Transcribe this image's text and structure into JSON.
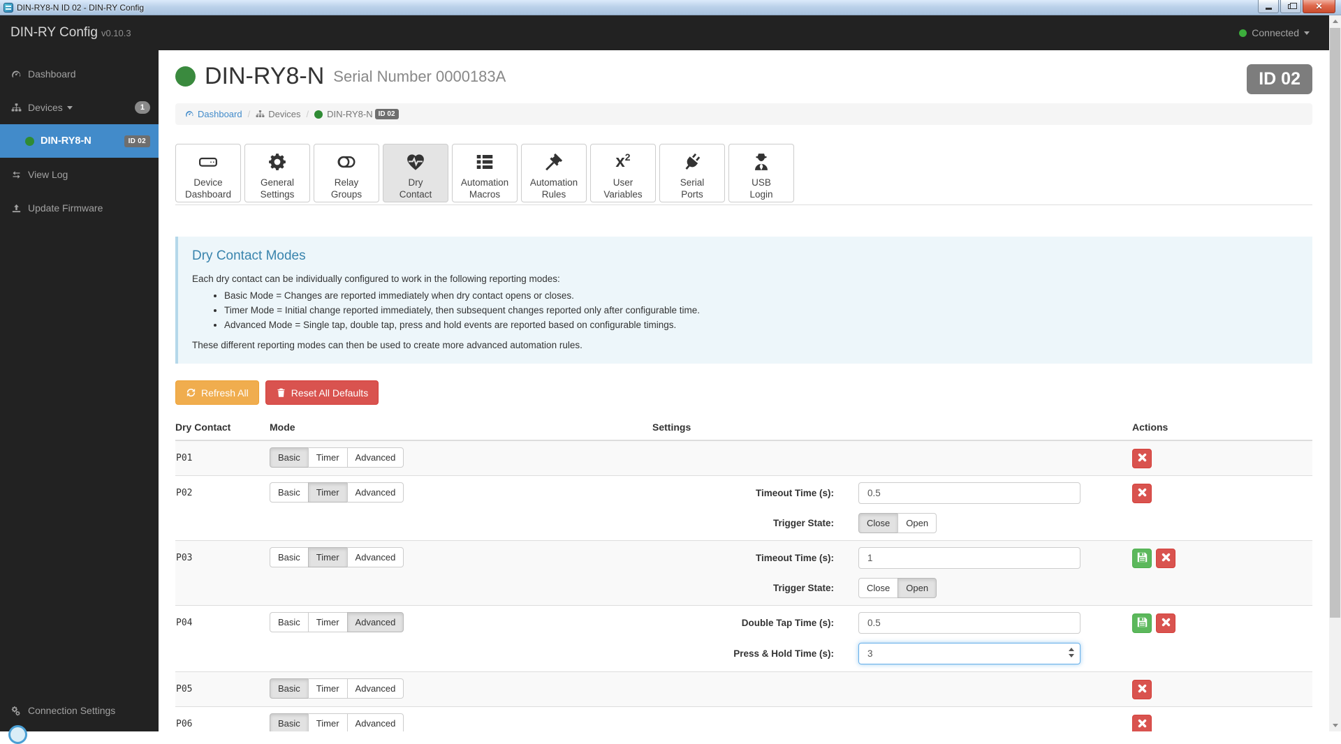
{
  "window": {
    "title": "DIN-RY8-N ID 02 - DIN-RY Config"
  },
  "app": {
    "brand": "DIN-RY Config",
    "version": "v0.10.3",
    "connection_status": "Connected",
    "status_color": "#3cae3c"
  },
  "sidebar": {
    "items": [
      {
        "label": "Dashboard",
        "icon": "dashboard-icon",
        "active": false
      },
      {
        "label": "Devices",
        "icon": "sitemap-icon",
        "caret": true,
        "badge": "1",
        "active": false
      },
      {
        "label": "DIN-RY8-N",
        "icon": "green-dot",
        "badge": "ID 02",
        "active": true
      },
      {
        "label": "View Log",
        "icon": "exchange-icon",
        "active": false
      },
      {
        "label": "Update Firmware",
        "icon": "upload-icon",
        "active": false
      }
    ],
    "footer": {
      "label": "Connection Settings",
      "icon": "cogs-icon"
    }
  },
  "page": {
    "device_name": "DIN-RY8-N",
    "serial_label": "Serial Number 0000183A",
    "id_badge": "ID 02",
    "status_color": "#3a8a3e",
    "breadcrumb": [
      {
        "label": "Dashboard",
        "icon": "dashboard-icon",
        "link": true
      },
      {
        "label": "Devices",
        "icon": "sitemap-icon",
        "link": false
      },
      {
        "label": "DIN-RY8-N",
        "icon": "green-dot",
        "badge": "ID 02",
        "link": false
      }
    ]
  },
  "tabs": [
    {
      "lines": [
        "Device",
        "Dashboard"
      ],
      "icon": "hdd-icon",
      "active": false
    },
    {
      "lines": [
        "General",
        "Settings"
      ],
      "icon": "gear-icon",
      "active": false
    },
    {
      "lines": [
        "Relay",
        "Groups"
      ],
      "icon": "toggle-icon",
      "active": false
    },
    {
      "lines": [
        "Dry",
        "Contact"
      ],
      "icon": "heartbeat-icon",
      "active": true
    },
    {
      "lines": [
        "Automation",
        "Macros"
      ],
      "icon": "thlist-icon",
      "active": false
    },
    {
      "lines": [
        "Automation",
        "Rules"
      ],
      "icon": "gavel-icon",
      "active": false
    },
    {
      "lines": [
        "User",
        "Variables"
      ],
      "icon": "x2-icon",
      "active": false
    },
    {
      "lines": [
        "Serial",
        "Ports"
      ],
      "icon": "plug-icon",
      "active": false
    },
    {
      "lines": [
        "USB",
        "Login"
      ],
      "icon": "usersecret-icon",
      "active": false
    }
  ],
  "info_panel": {
    "title": "Dry Contact Modes",
    "intro": "Each dry contact can be individually configured to work in the following reporting modes:",
    "bullets": [
      "Basic Mode = Changes are reported immediately when dry contact opens or closes.",
      "Timer Mode = Initial change reported immediately, then subsequent changes reported only after configurable time.",
      "Advanced Mode = Single tap, double tap, press and hold events are reported based on configurable timings."
    ],
    "outro": "These different reporting modes can then be used to create more advanced automation rules."
  },
  "toolbar": {
    "refresh_label": "Refresh All",
    "reset_label": "Reset All Defaults",
    "refresh_color": "#f0ad4e",
    "reset_color": "#d9534f"
  },
  "table": {
    "headers": [
      "Dry Contact",
      "Mode",
      "Settings",
      "Actions"
    ],
    "mode_options": [
      "Basic",
      "Timer",
      "Advanced"
    ],
    "rows": [
      {
        "name": "P01",
        "mode": "Basic",
        "settings": [],
        "actions": [
          "delete"
        ]
      },
      {
        "name": "P02",
        "mode": "Timer",
        "settings": [
          {
            "kind": "text",
            "name": "timeout-time",
            "label": "Timeout Time (s):",
            "value": "0.5"
          },
          {
            "kind": "toggle",
            "name": "trigger-state",
            "label": "Trigger State:",
            "options": [
              "Close",
              "Open"
            ],
            "selected": "Close"
          }
        ],
        "actions": [
          "delete"
        ]
      },
      {
        "name": "P03",
        "mode": "Timer",
        "settings": [
          {
            "kind": "text",
            "name": "timeout-time",
            "label": "Timeout Time (s):",
            "value": "1"
          },
          {
            "kind": "toggle",
            "name": "trigger-state",
            "label": "Trigger State:",
            "options": [
              "Close",
              "Open"
            ],
            "selected": "Open"
          }
        ],
        "actions": [
          "save",
          "delete"
        ]
      },
      {
        "name": "P04",
        "mode": "Advanced",
        "settings": [
          {
            "kind": "text",
            "name": "double-tap-time",
            "label": "Double Tap Time (s):",
            "value": "0.5"
          },
          {
            "kind": "number",
            "name": "press-hold-time",
            "label": "Press & Hold Time (s):",
            "value": "3",
            "focused": true
          }
        ],
        "actions": [
          "save",
          "delete"
        ]
      },
      {
        "name": "P05",
        "mode": "Basic",
        "settings": [],
        "actions": [
          "delete"
        ]
      },
      {
        "name": "P06",
        "mode": "Basic",
        "settings": [],
        "actions": [
          "delete"
        ]
      }
    ]
  },
  "colors": {
    "accent_blue": "#428bca",
    "dark_bg": "#222222",
    "save_green": "#5cb85c",
    "delete_red": "#d9534f",
    "info_bg": "#edf6fa",
    "info_border": "#b5d8ea",
    "info_title": "#3984ad"
  }
}
